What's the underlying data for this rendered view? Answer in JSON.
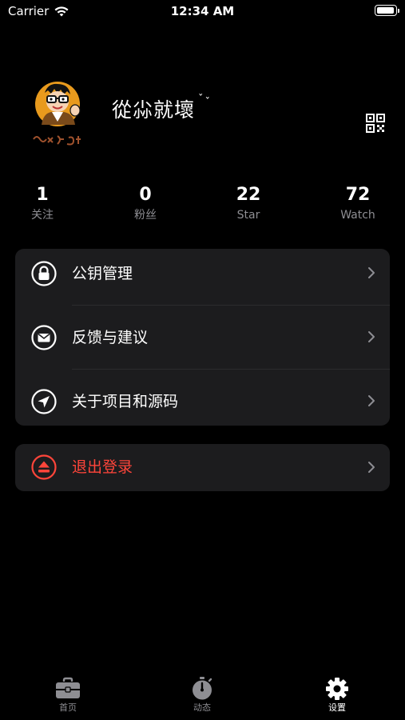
{
  "status_bar": {
    "carrier": "Carrier",
    "time": "12:34 AM",
    "battery_level": 1.0
  },
  "profile": {
    "username": "從尛就壞",
    "username_chevron": "ˇ",
    "avatar_icon": "cartoon-avatar",
    "qr_icon": "qr-code-icon"
  },
  "stats": [
    {
      "value": "1",
      "label": "关注"
    },
    {
      "value": "0",
      "label": "粉丝"
    },
    {
      "value": "22",
      "label": "Star"
    },
    {
      "value": "72",
      "label": "Watch"
    }
  ],
  "menu": [
    {
      "label": "公钥管理",
      "icon": "lock-icon"
    },
    {
      "label": "反馈与建议",
      "icon": "envelope-icon"
    },
    {
      "label": "关于项目和源码",
      "icon": "paper-plane-icon"
    }
  ],
  "logout": {
    "label": "退出登录",
    "icon": "eject-icon",
    "color": "#ff453a"
  },
  "tabbar": [
    {
      "label": "首页",
      "icon": "briefcase-icon",
      "active": false
    },
    {
      "label": "动态",
      "icon": "stopwatch-icon",
      "active": false
    },
    {
      "label": "设置",
      "icon": "gear-icon",
      "active": true
    }
  ],
  "colors": {
    "background": "#000000",
    "card": "#1c1c1e",
    "secondary_text": "#8e8e93",
    "destructive": "#ff453a"
  }
}
